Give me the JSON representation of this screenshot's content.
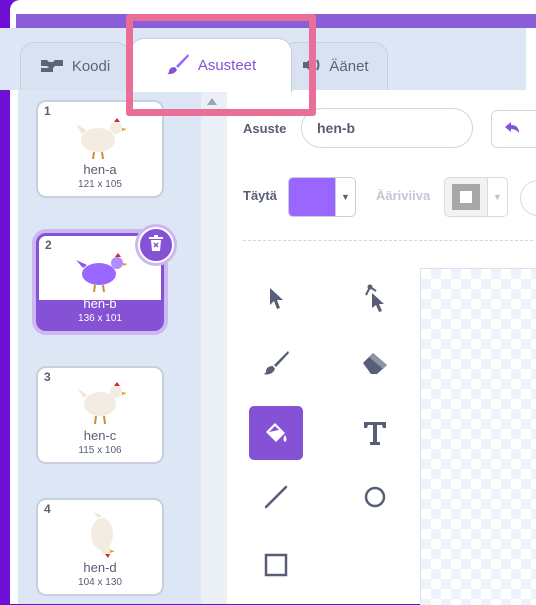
{
  "tabs": {
    "code": "Koodi",
    "costumes": "Asusteet",
    "sounds": "Äänet"
  },
  "costumes": [
    {
      "number": "1",
      "name": "hen-a",
      "size": "121 x 105",
      "selected": false
    },
    {
      "number": "2",
      "name": "hen-b",
      "size": "136 x 101",
      "selected": true
    },
    {
      "number": "3",
      "name": "hen-c",
      "size": "115 x 106",
      "selected": false
    },
    {
      "number": "4",
      "name": "hen-d",
      "size": "104 x 130",
      "selected": false
    }
  ],
  "editor": {
    "costume_label": "Asuste",
    "costume_name": "hen-b",
    "fill_label": "Täytä",
    "outline_label": "Ääriviiva"
  },
  "colors": {
    "accent": "#8552d6",
    "fill": "#9966ff",
    "highlight": "#ea6f98",
    "background": "#6f0fd6"
  },
  "tools": [
    "select-icon",
    "reshape-icon",
    "brush-icon",
    "eraser-icon",
    "fill-icon",
    "text-icon",
    "line-icon",
    "circle-icon",
    "rectangle-icon"
  ]
}
